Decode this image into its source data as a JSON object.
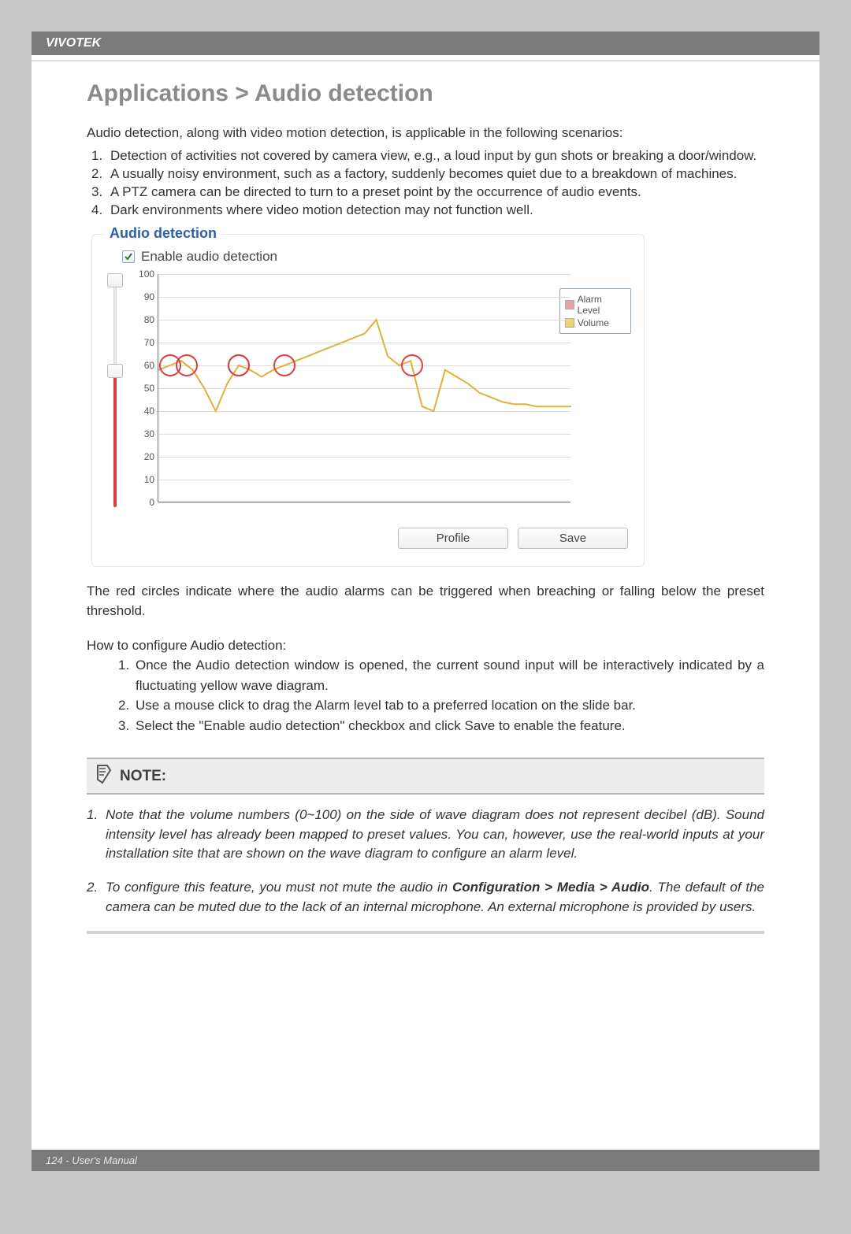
{
  "header": {
    "brand": "VIVOTEK"
  },
  "page": {
    "title": "Applications > Audio detection",
    "intro": "Audio detection, along with video motion detection, is applicable in the following scenarios:",
    "scenarios": [
      "Detection of activities not covered by camera view, e.g., a loud input by gun shots or breaking a door/window.",
      "A usually noisy environment, such as a factory, suddenly becomes quiet due to a breakdown of machines.",
      "A PTZ camera can be directed to turn to a preset point by the occurrence of audio events.",
      "Dark environments where video motion detection may not function well."
    ],
    "red_para": "The red circles indicate where the audio alarms can be triggered when breaching or falling below the preset threshold.",
    "howto_title": "How to configure Audio detection:",
    "howto": [
      "Once the Audio detection window is opened, the current sound input will be interactively indicated by a fluctuating yellow wave diagram.",
      "Use a mouse click to drag the Alarm level tab to a preferred location on the slide bar.",
      "Select the \"Enable audio detection\" checkbox and click Save to enable the feature."
    ]
  },
  "panel": {
    "legend": "Audio detection",
    "checkbox_label": "Enable audio detection",
    "checkbox_checked": true,
    "buttons": {
      "profile": "Profile",
      "save": "Save"
    },
    "slider": {
      "alarm_level": 60,
      "range": [
        0,
        100
      ]
    },
    "chart_legend": {
      "alarm": "Alarm Level",
      "volume": "Volume"
    }
  },
  "chart_data": {
    "type": "line",
    "title": "",
    "xlabel": "",
    "ylabel": "",
    "ylim": [
      0,
      100
    ],
    "yticks": [
      0,
      10,
      20,
      30,
      40,
      50,
      60,
      70,
      80,
      90,
      100
    ],
    "series": [
      {
        "name": "Volume",
        "color": "#e0b03a",
        "values": [
          58,
          60,
          62,
          58,
          50,
          40,
          52,
          60,
          58,
          55,
          58,
          60,
          62,
          64,
          66,
          68,
          70,
          72,
          74,
          80,
          64,
          60,
          62,
          42,
          40,
          58,
          55,
          52,
          48,
          46,
          44,
          43,
          43,
          42,
          42,
          42,
          42
        ]
      }
    ],
    "alarm_level": 60
  },
  "note": {
    "label": "NOTE:",
    "items": [
      {
        "pre": "Note that the volume numbers (0~100) on the side of wave diagram does not represent decibel (dB). Sound intensity level has already been mapped to preset values. You can, however, use the real-world inputs at your installation site that are shown on the wave diagram to configure an alarm level.",
        "bold": "",
        "post": ""
      },
      {
        "pre": "To configure this feature, you must not mute the audio in ",
        "bold": "Configuration > Media > Audio",
        "post": ". The default of the camera can be muted due to the lack of an internal microphone. An external microphone is provided by users."
      }
    ]
  },
  "footer": {
    "text": "124 - User's Manual"
  }
}
